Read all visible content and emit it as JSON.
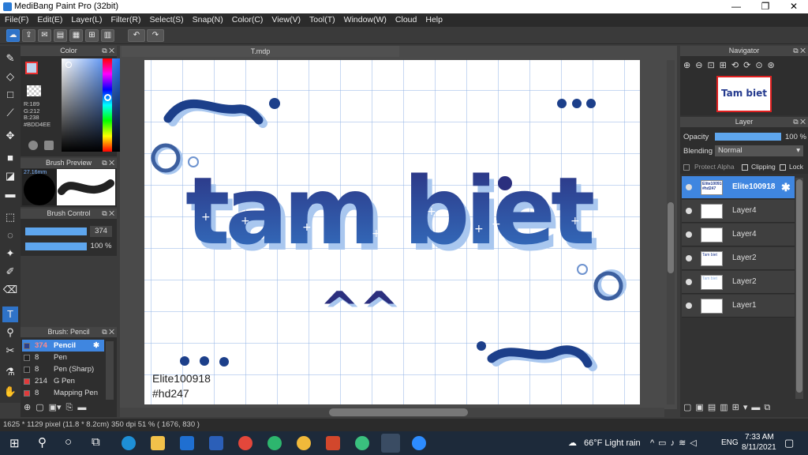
{
  "window": {
    "title": "MediBang Paint Pro (32bit)",
    "minimize": "—",
    "restore": "❐",
    "close": "✕"
  },
  "menu": [
    "File(F)",
    "Edit(E)",
    "Layer(L)",
    "Filter(R)",
    "Select(S)",
    "Snap(N)",
    "Color(C)",
    "View(V)",
    "Tool(T)",
    "Window(W)",
    "Cloud",
    "Help"
  ],
  "document": {
    "tab": "T.mdp"
  },
  "color_panel": {
    "title": "Color",
    "r": "R:189",
    "g": "G:212",
    "b": "B:238",
    "hex": "#BDD4EE"
  },
  "brush_preview": {
    "title": "Brush Preview",
    "size": "27.16mm"
  },
  "brush_control": {
    "title": "Brush Control",
    "size_value": "374",
    "opacity_value": "100 %"
  },
  "brush_list": {
    "title": "Brush: Pencil",
    "items": [
      {
        "size": "374",
        "name": "Pencil",
        "color": "#2b3f8a"
      },
      {
        "size": "8",
        "name": "Pen",
        "color": "#222222"
      },
      {
        "size": "8",
        "name": "Pen (Sharp)",
        "color": "#222222"
      },
      {
        "size": "214",
        "name": "G Pen",
        "color": "#e03a3a"
      },
      {
        "size": "8",
        "name": "Mapping Pen",
        "color": "#e03a3a"
      }
    ]
  },
  "canvas": {
    "main_text": "tam biet",
    "sub_text": "^^",
    "credit_line1": "Elite100918",
    "credit_line2": "#hd247"
  },
  "navigator": {
    "title": "Navigator",
    "thumb_text": "Tam biet"
  },
  "layer_panel": {
    "title": "Layer",
    "opacity_label": "Opacity",
    "opacity_value": "100 %",
    "blending_label": "Blending",
    "blending_value": "Normal",
    "protect_alpha": "Protect Alpha",
    "clipping": "Clipping",
    "lock": "Lock",
    "layers": [
      {
        "name": "Elite100918",
        "thumb": "Elite100918 #hd247"
      },
      {
        "name": "Layer4",
        "thumb": ""
      },
      {
        "name": "Layer4",
        "thumb": ""
      },
      {
        "name": "Layer2",
        "thumb": "Tam biet"
      },
      {
        "name": "Layer2",
        "thumb": "Tam biet"
      },
      {
        "name": "Layer1",
        "thumb": ""
      }
    ]
  },
  "status": "1625 * 1129 pixel   (11.8 * 8.2cm)  350 dpi   51 %   ( 1676, 830 )",
  "taskbar": {
    "weather": "66°F  Light rain",
    "lang": "ENG",
    "time": "7:33 AM",
    "date": "8/11/2021"
  },
  "colors": {
    "accent": "#2f73c8",
    "ink": "#243a8e",
    "ink_dark": "#1c3f8a",
    "highlight": "#a9c7ef"
  }
}
